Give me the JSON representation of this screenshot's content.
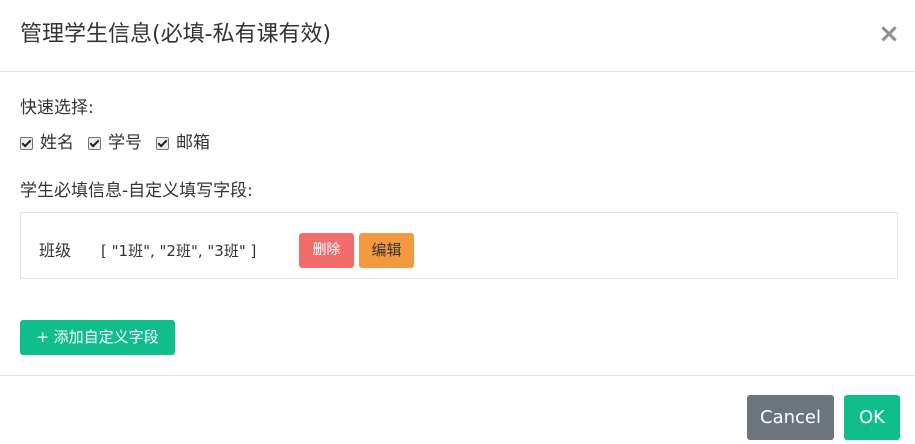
{
  "modal": {
    "title": "管理学生信息(必填-私有课有效)",
    "close_glyph": "×"
  },
  "quick_select": {
    "label": "快速选择:",
    "options": [
      {
        "label": "姓名",
        "checked": true
      },
      {
        "label": "学号",
        "checked": true
      },
      {
        "label": "邮箱",
        "checked": true
      }
    ]
  },
  "custom_fields": {
    "label": "学生必填信息-自定义填写字段:",
    "fields": [
      {
        "name": "班级",
        "values": "[ \"1班\", \"2班\", \"3班\" ]",
        "delete_label": "删除",
        "edit_label": "编辑"
      }
    ],
    "add_label": "+ 添加自定义字段"
  },
  "footer": {
    "cancel_label": "Cancel",
    "ok_label": "OK"
  },
  "colors": {
    "primary": "#10be8c",
    "danger": "#f26c6c",
    "warning": "#f39a40",
    "secondary": "#6c757d"
  }
}
